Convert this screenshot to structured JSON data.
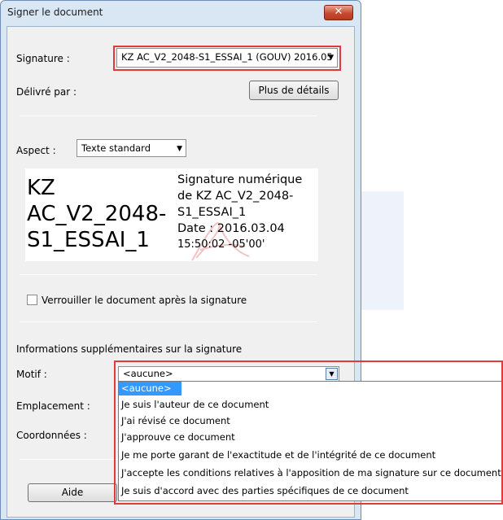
{
  "dialog": {
    "title": "Signer le document",
    "close_glyph": "✕"
  },
  "signature": {
    "label": "Signature :",
    "value": "KZ AC_V2_2048-S1_ESSAI_1 (GOUV) 2016.05"
  },
  "issued_by": {
    "label": "Délivré par :",
    "details_button": "Plus de détails"
  },
  "appearance": {
    "label": "Aspect :",
    "value": "Texte standard"
  },
  "preview": {
    "name_lines": [
      "KZ",
      "AC_V2_2048-",
      "S1_ESSAI_1"
    ],
    "info_lines": [
      "Signature numérique",
      "de KZ AC_V2_2048-",
      "S1_ESSAI_1",
      "Date : 2016.03.04"
    ],
    "time_line": "15:50:02 -05'00'"
  },
  "lock": {
    "label": "Verrouiller le document après la signature",
    "checked": false
  },
  "extra": {
    "heading": "Informations supplémentaires sur la signature",
    "reason_label": "Motif :",
    "reason_value": "<aucune>",
    "location_label": "Emplacement :",
    "contact_label": "Coordonnées :"
  },
  "reason_options": [
    "<aucune>",
    "Je suis l'auteur de ce document",
    "J'ai révisé ce document",
    "J'approuve ce document",
    "Je me porte garant de l'exactitude et de l'intégrité de ce document",
    "J'accepte les conditions relatives à l'apposition de ma signature sur ce document",
    "Je suis d'accord avec des parties spécifiques de ce document"
  ],
  "footer": {
    "help_button": "Aide"
  },
  "colors": {
    "highlight_frame": "#e03a3a",
    "selection": "#3399ff"
  }
}
